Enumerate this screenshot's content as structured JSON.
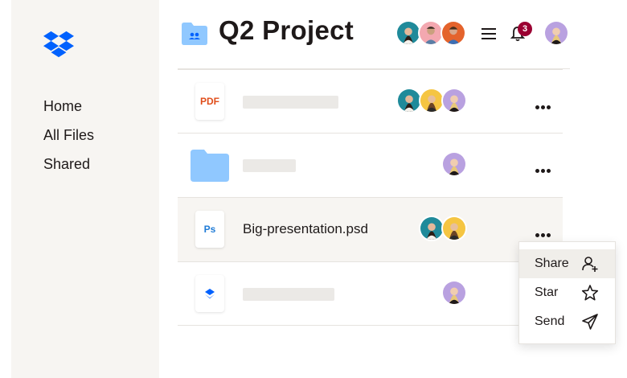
{
  "app": {
    "brand_color": "#0061fe",
    "logo_icon": "dropbox-logo"
  },
  "sidebar": {
    "items": [
      {
        "label": "Home"
      },
      {
        "label": "All Files"
      },
      {
        "label": "Shared"
      }
    ]
  },
  "header": {
    "title": "Q2 Project",
    "folder_icon": "shared-folder-icon",
    "menu_icon": "hamburger-icon",
    "notifications": {
      "icon": "bell-icon",
      "count": "3",
      "badge_color": "#9b0032"
    },
    "members": [
      "avatar",
      "avatar",
      "avatar"
    ]
  },
  "files": [
    {
      "type": "pdf",
      "type_label": "PDF",
      "name": "",
      "avatars": 3
    },
    {
      "type": "folder",
      "type_label": "",
      "name": "",
      "avatars": 1
    },
    {
      "type": "psd",
      "type_label": "Ps",
      "name": "Big-presentation.psd",
      "avatars": 2
    },
    {
      "type": "dropbox",
      "type_label": "",
      "name": "",
      "avatars": 1
    }
  ],
  "context_menu": {
    "items": [
      {
        "label": "Share",
        "icon": "add-user-icon"
      },
      {
        "label": "Star",
        "icon": "star-icon"
      },
      {
        "label": "Send",
        "icon": "send-icon"
      }
    ]
  },
  "colors": {
    "sidebar_bg": "#f7f5f2",
    "folder_blue": "#90c8ff",
    "pdf_red": "#e04e1b",
    "ps_blue": "#1f7bd6"
  }
}
